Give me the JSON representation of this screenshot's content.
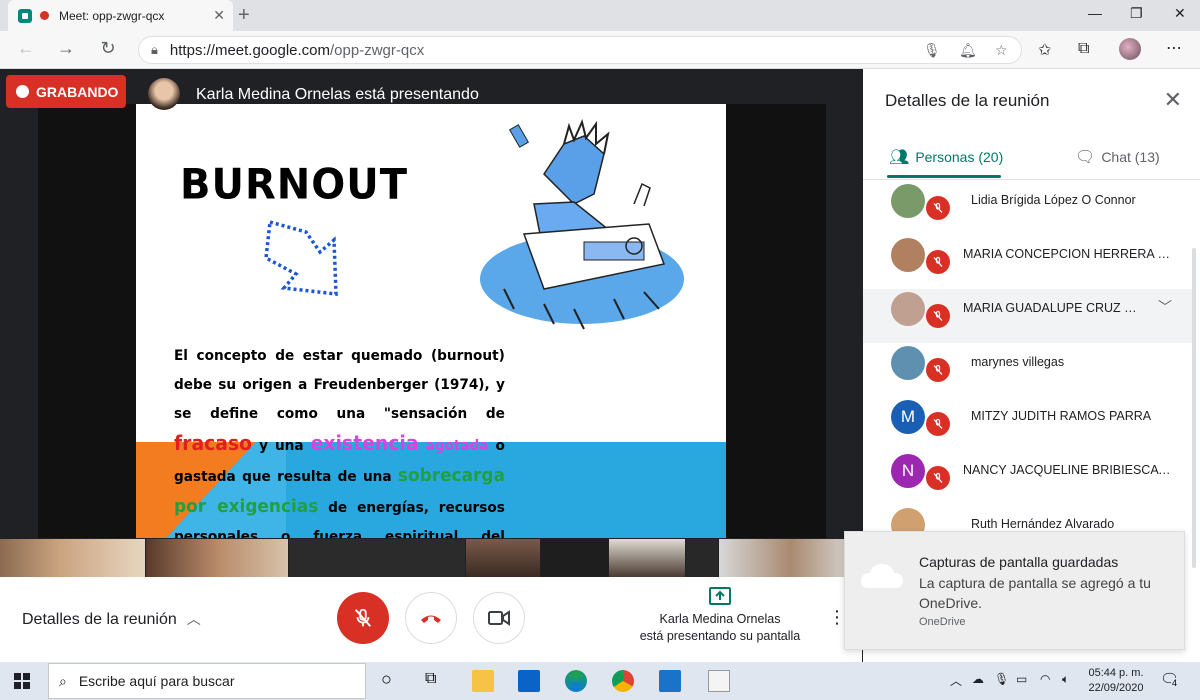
{
  "browser": {
    "tab_title": "Meet: opp-zwgr-qcx",
    "url_host": "https://meet.google.com",
    "url_path": "/opp-zwgr-qcx"
  },
  "meeting": {
    "recording_label": "GRABANDO",
    "presenter_banner": "Karla Medina Ornelas está presentando"
  },
  "slide": {
    "title": "BURNOUT",
    "body_1": "El concepto de estar quemado (burnout) debe su origen a Freudenberger (1974), y se define como una \"sensación de ",
    "body_fracaso": "fracaso",
    "body_2": " y una ",
    "body_existencia": "existencia",
    "body_agotada": "agotada",
    "body_3": " o gastada que resulta de una ",
    "body_sobrecarga": "sobrecarga por exigencias",
    "body_4": " de energías, recursos personales o fuerza espiritual del trabajador\"."
  },
  "bottombar": {
    "details_label": "Detalles de la reunión",
    "presenting_line1": "Karla Medina Ornelas",
    "presenting_line2": "está presentando su pantalla"
  },
  "panel": {
    "title": "Detalles de la reunión",
    "tab_people": "Personas (20)",
    "tab_chat": "Chat (13)",
    "people": [
      {
        "name": "Lidia Brígida López O Connor",
        "initial": "",
        "color": "#7a9a6a"
      },
      {
        "name": "MARIA CONCEPCION HERRERA SAN...",
        "initial": "",
        "color": "#b08060"
      },
      {
        "name": "MARIA GUADALUPE CRUZ RIV...",
        "initial": "",
        "color": "#c0a090"
      },
      {
        "name": "marynes villegas",
        "initial": "",
        "color": "#6090b0"
      },
      {
        "name": "MITZY JUDITH RAMOS PARRA",
        "initial": "M",
        "color": "#1a5fb4"
      },
      {
        "name": "NANCY JACQUELINE BRIBIESCA RA...",
        "initial": "N",
        "color": "#9c27b0"
      },
      {
        "name": "Ruth Hernández Alvarado",
        "initial": "",
        "color": "#d0a070"
      }
    ]
  },
  "toast": {
    "title": "Capturas de pantalla guardadas",
    "body": "La captura de pantalla se agregó a tu OneDrive.",
    "source": "OneDrive"
  },
  "taskbar": {
    "search_placeholder": "Escribe aquí para buscar",
    "time": "05:44 p. m.",
    "date": "22/09/2020",
    "notifications": "4"
  },
  "colors": {
    "recording": "#d93025",
    "meet_accent": "#00796b",
    "slide_blue": "#29a8e0",
    "slide_orange": "#f47c20"
  }
}
